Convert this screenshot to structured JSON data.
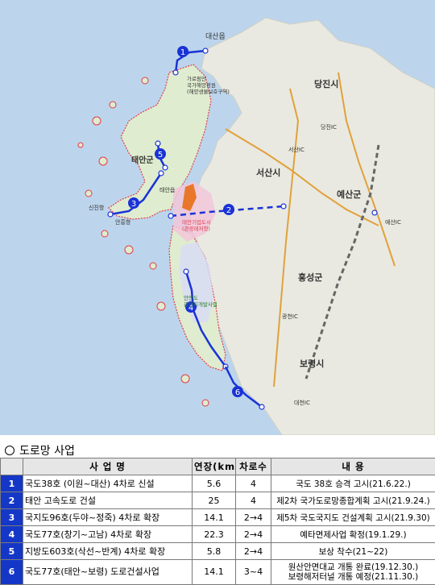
{
  "map": {
    "colors": {
      "sea": "#bcd5ec",
      "land": "#e9e9e1",
      "park": "#dfeccf",
      "route": "#1a33d6",
      "region_pink": "#f2c7d9",
      "region_blue": "#d8dcf7",
      "industrial": "#e8772a"
    },
    "labels": {
      "daesan": "대산읍",
      "anmyeon_area": "가로림만\n국가해양정원\n(해양생물보호구역)",
      "dangjin": "당진시",
      "dangjin_ic": "당진IC",
      "seosan": "서산시",
      "seosan_ic": "서산IC",
      "taean_gun": "태안군",
      "yesan": "예산군",
      "yesan_ic": "예산IC",
      "hongseong": "홍성군",
      "gwangcheon_ic": "광천IC",
      "boryeong": "보령시",
      "daecheon_ic": "대천IC",
      "sinjin": "신진항",
      "anheung": "안흥항",
      "taean_enterprise": "태안기업도시\n(관광레저형)",
      "anmyeon_tourist": "안면도\n관광지개발사업",
      "taean_label": "태안읍"
    },
    "routes": [
      {
        "id": "1",
        "label": "1"
      },
      {
        "id": "2",
        "label": "2"
      },
      {
        "id": "3",
        "label": "3"
      },
      {
        "id": "4",
        "label": "4"
      },
      {
        "id": "5",
        "label": "5"
      },
      {
        "id": "6",
        "label": "6"
      }
    ]
  },
  "section": {
    "title": "도로망 사업"
  },
  "table": {
    "headers": [
      "",
      "사 업 명",
      "연장(km)",
      "차로수",
      "내 용"
    ],
    "rows": [
      {
        "num": "1",
        "name": "국도38호 (이원~대산) 4차로 신설",
        "length": "5.6",
        "lanes": "4",
        "content": "국도 38호 승격 고시(21.6.22.)"
      },
      {
        "num": "2",
        "name": "태안 고속도로 건설",
        "length": "25",
        "lanes": "4",
        "content": "제2차 국가도로망종합계획 고시(21.9.24.)"
      },
      {
        "num": "3",
        "name": "국지도96호(두야~정죽) 4차로 확장",
        "length": "14.1",
        "lanes": "2→4",
        "content": "제5차 국도국지도 건설계획 고시(21.9.30)"
      },
      {
        "num": "4",
        "name": "국도77호(창기~고남) 4차로 확장",
        "length": "22.3",
        "lanes": "2→4",
        "content": "예타면제사업 확정(19.1.29.)"
      },
      {
        "num": "5",
        "name": "지방도603호(삭선~반계) 4차로 확장",
        "length": "5.8",
        "lanes": "2→4",
        "content": "보상 착수(21~22)"
      },
      {
        "num": "6",
        "name": "국도77호(태안~보령) 도로건설사업",
        "length": "14.1",
        "lanes": "3~4",
        "content": "원산안면대교 개통 완료(19.12.30.)\n보령해저터널 개통 예정(21.11.30.)"
      }
    ]
  }
}
